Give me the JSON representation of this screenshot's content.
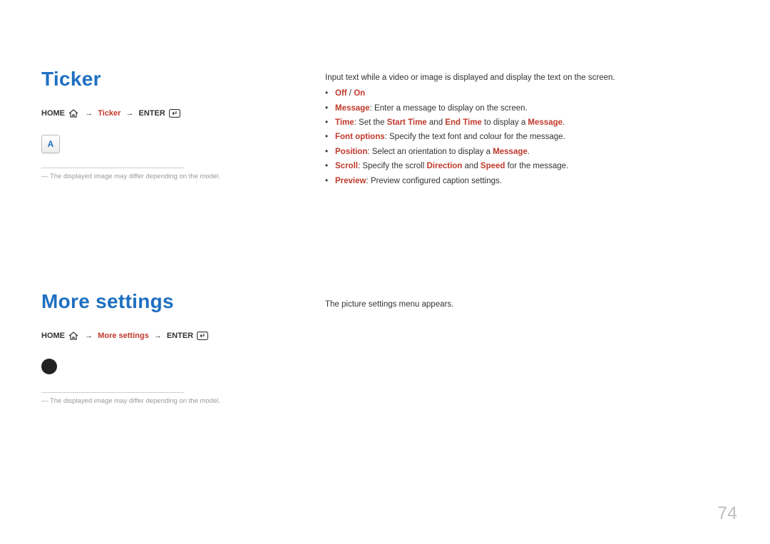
{
  "section1": {
    "heading": "Ticker",
    "nav": {
      "home": "HOME",
      "step": "Ticker",
      "enter": "ENTER"
    },
    "iconLetter": "A",
    "footnote": "The displayed image may differ depending on the model.",
    "rightIntro": "Input text while a video or image is displayed and display the text on the screen.",
    "bullets": {
      "offon": {
        "off": "Off",
        "slash": " / ",
        "on": "On"
      },
      "message": {
        "label": "Message",
        "text": ": Enter a message to display on the screen."
      },
      "time": {
        "label": "Time",
        "text1": ": Set the ",
        "start": "Start Time",
        "text2": " and ",
        "end": "End Time",
        "text3": " to display a ",
        "msg": "Message",
        "dot": "."
      },
      "font": {
        "label": "Font options",
        "text": ": Specify the text font and colour for the message."
      },
      "position": {
        "label": "Position",
        "text1": ": Select an orientation to display a ",
        "msg": "Message",
        "dot": "."
      },
      "scroll": {
        "label": "Scroll",
        "text1": ": Specify the scroll ",
        "dir": "Direction",
        "text2": " and ",
        "speed": "Speed",
        "text3": " for the message."
      },
      "preview": {
        "label": "Preview",
        "text": ": Preview configured caption settings."
      }
    }
  },
  "section2": {
    "heading": "More settings",
    "nav": {
      "home": "HOME",
      "step": "More settings",
      "enter": "ENTER"
    },
    "footnote": "The displayed image may differ depending on the model.",
    "rightIntro": "The picture settings menu appears."
  },
  "pageNumber": "74"
}
